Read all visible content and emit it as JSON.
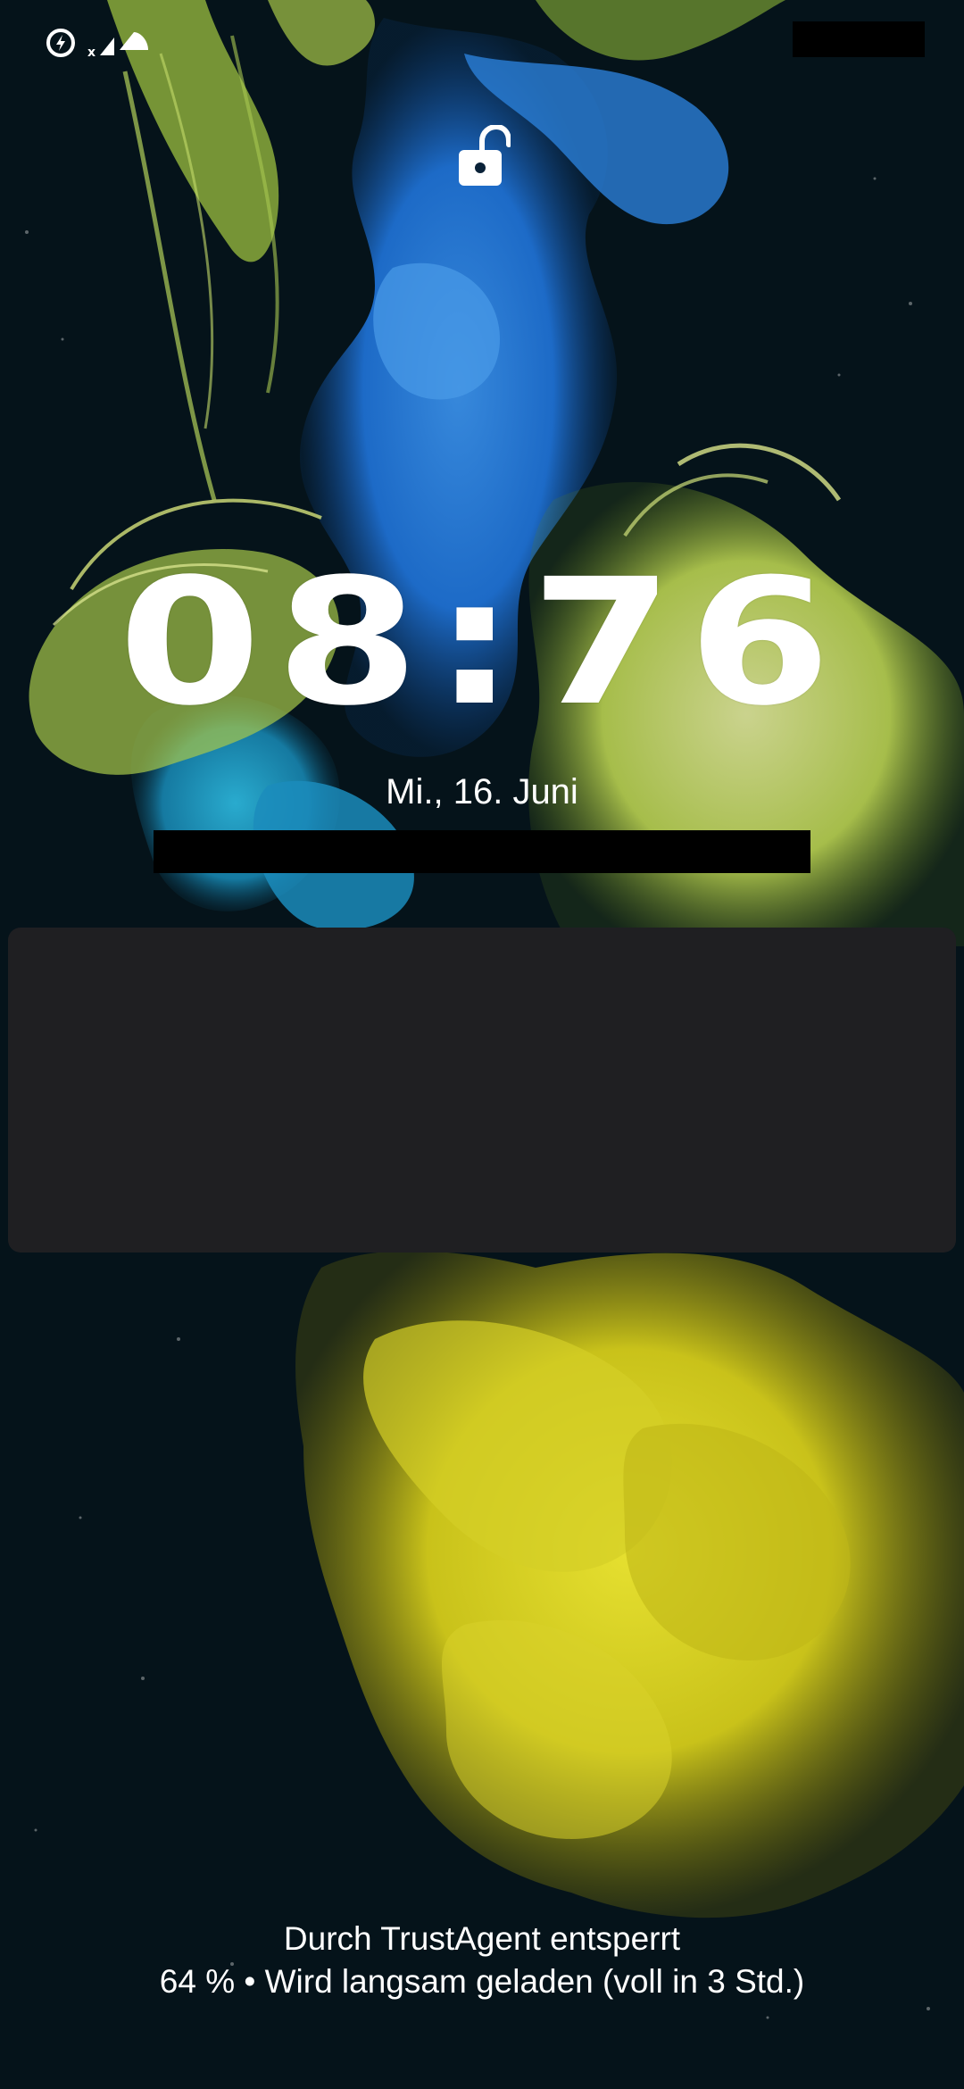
{
  "status_bar": {
    "icons": [
      "data-saver-icon",
      "no-signal-icon",
      "wifi-icon"
    ]
  },
  "lockscreen": {
    "lock_icon": "unlocked-padlock-icon",
    "clock": "08:76",
    "date": "Mi., 16. Juni"
  },
  "notification_card": {
    "items": []
  },
  "footer": {
    "trust_agent_text": "Durch TrustAgent entsperrt",
    "charging_text": "64 % • Wird langsam geladen (voll in 3 Std.)"
  },
  "colors": {
    "ink_blue": "#1e6fd0",
    "ink_teal": "#1aa0c8",
    "ink_yellow": "#d9d420",
    "ink_green": "#b8d64a",
    "background": "#05131a",
    "card": "#1f1f22"
  }
}
